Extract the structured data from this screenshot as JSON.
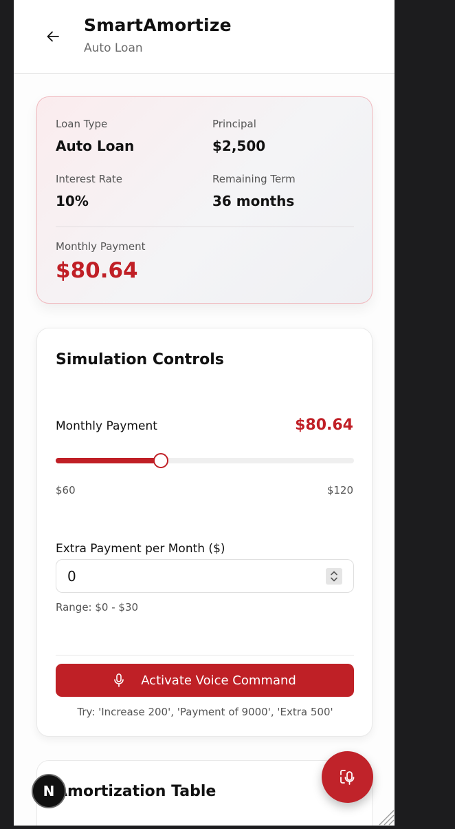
{
  "header": {
    "title": "SmartAmortize",
    "subtitle": "Auto Loan"
  },
  "summary": {
    "loan_type_label": "Loan Type",
    "loan_type_value": "Auto Loan",
    "principal_label": "Principal",
    "principal_value": "$2,500",
    "interest_label": "Interest Rate",
    "interest_value": "10%",
    "term_label": "Remaining Term",
    "term_value": "36 months",
    "payment_label": "Monthly Payment",
    "payment_value": "$80.64"
  },
  "simulation": {
    "title": "Simulation Controls",
    "monthly_payment_label": "Monthly Payment",
    "monthly_payment_value": "$80.64",
    "slider_min_label": "$60",
    "slider_max_label": "$120",
    "slider_fraction": 0.353,
    "extra_label": "Extra Payment per Month ($)",
    "extra_value": "0",
    "extra_range": "Range: $0 - $30",
    "voice_button": "Activate Voice Command",
    "voice_hint": "Try: 'Increase 200', 'Payment of 9000', 'Extra 500'"
  },
  "amortization": {
    "title": "Amortization Table"
  },
  "badge": {
    "letter": "N"
  },
  "colors": {
    "accent": "#c01f26",
    "background": "#fdfdfd"
  },
  "icons": {
    "back": "arrow-left-icon",
    "voice": "microphone-icon",
    "fab": "voice-assistant-icon"
  }
}
